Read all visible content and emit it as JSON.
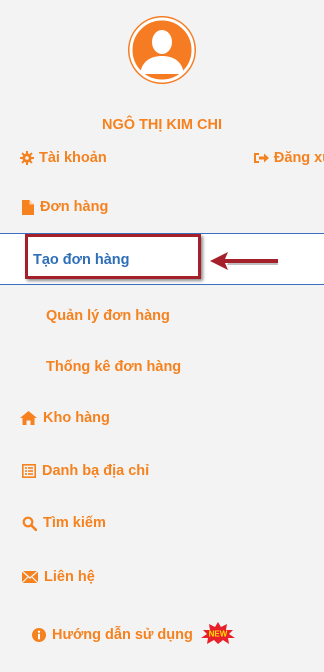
{
  "profile": {
    "name": "NGÔ THỊ KIM CHI",
    "avatar_icon": "user-silhouette-icon"
  },
  "account": {
    "account_label": "Tài khoản",
    "logout_label": "Đăng xuất"
  },
  "menu": {
    "orders": {
      "label": "Đơn hàng",
      "icon": "file-icon"
    },
    "submenu": {
      "create": "Tạo đơn hàng",
      "manage": "Quản lý đơn hàng",
      "stats": "Thống kê đơn hàng"
    },
    "warehouse": {
      "label": "Kho hàng",
      "icon": "home-icon"
    },
    "address_book": {
      "label": "Danh bạ địa chỉ",
      "icon": "list-icon"
    },
    "search": {
      "label": "Tìm kiếm",
      "icon": "search-icon"
    },
    "contact": {
      "label": "Liên hệ",
      "icon": "envelope-icon"
    },
    "guide": {
      "label": "Hướng dẫn sử dụng",
      "icon": "info-icon",
      "badge": "NEW"
    }
  },
  "colors": {
    "accent": "#f5821f",
    "active_text": "#2f6fb8",
    "highlight_border": "#a4202a",
    "active_band_border": "#3b6fc2",
    "background": "#f3f3f3"
  }
}
